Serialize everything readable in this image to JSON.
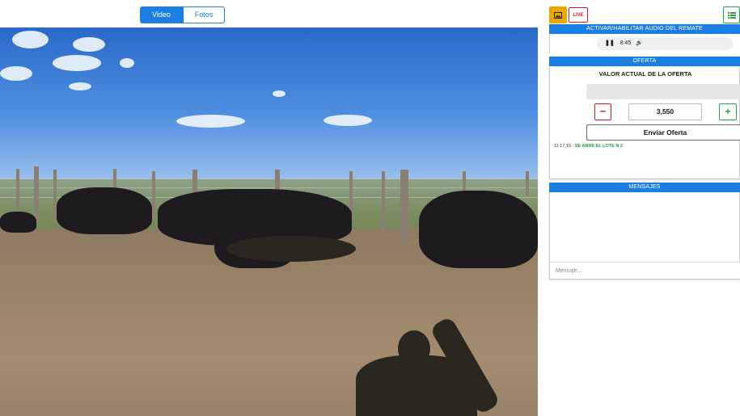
{
  "media_tabs": [
    {
      "label": "Video",
      "active": true
    },
    {
      "label": "Fotos",
      "active": false
    }
  ],
  "toolbar": {
    "image_icon": "image-icon",
    "live_label": "LIVE",
    "menu_icon": "list-menu-icon"
  },
  "audio": {
    "header": "ACTIVAR/HABILITAR AUDIO DEL REMATE",
    "time": "8:45",
    "pause_icon": "pause-icon",
    "volume_icon": "volume-icon"
  },
  "oferta": {
    "header": "OFERTA",
    "current_label": "VALOR ACTUAL DE LA OFERTA",
    "current_value": "",
    "minus_label": "−",
    "amount": "3,550",
    "plus_label": "+",
    "send_label": "Enviar Oferta",
    "log": [
      {
        "time": "11:17:19 - ",
        "text": "SE ABRE EL LOTE N 2"
      }
    ]
  },
  "mensajes": {
    "header": "MENSAJES",
    "placeholder": "Mensaje..."
  },
  "colors": {
    "primary": "#1a7fe0",
    "danger": "#d2192a",
    "success": "#26a04a",
    "warning": "#e8a800"
  }
}
